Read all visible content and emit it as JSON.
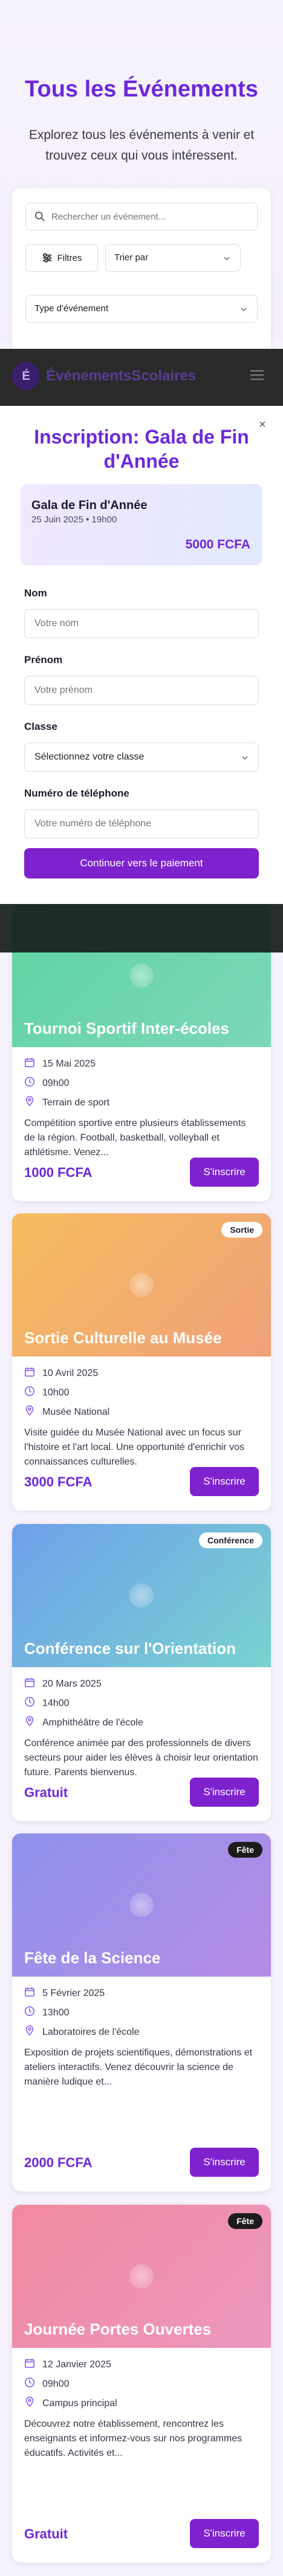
{
  "hero": {
    "title": "Tous les Événements",
    "subtitle": "Explorez tous les événements à venir et trouvez ceux qui vous intéressent."
  },
  "filters": {
    "search_placeholder": "Rechercher un événement...",
    "filter_button": "Filtres",
    "sort_label": "Trier par",
    "type_label": "Type d'événement"
  },
  "navbar": {
    "logo_letter": "É",
    "brand": "ÉvénementsScolaires"
  },
  "modal": {
    "title": "Inscription: Gala de Fin d'Année",
    "summary": {
      "name": "Gala de Fin d'Année",
      "date": "25 Juin 2025 • 19h00",
      "price": "5000 FCFA"
    },
    "form": {
      "name_label": "Nom",
      "name_placeholder": "Votre nom",
      "firstname_label": "Prénom",
      "firstname_placeholder": "Votre prénom",
      "class_label": "Classe",
      "class_value": "Sélectionnez votre classe",
      "phone_label": "Numéro de téléphone",
      "phone_placeholder": "Votre numéro de téléphone"
    },
    "continue_button": "Continuer vers le paiement"
  },
  "events": [
    {
      "title": "Tournoi Sportif Inter-écoles",
      "badge": "",
      "date": "15 Mai 2025",
      "time": "09h00",
      "place": "Terrain de sport",
      "description": "Compétition sportive entre plusieurs établissements de la région. Football, basketball, volleyball et athlétisme. Venez...",
      "price": "1000 FCFA",
      "button": "S'inscrire",
      "gradient": [
        "#5ed3a3",
        "#7dd7b8"
      ]
    },
    {
      "title": "Sortie Culturelle au Musée",
      "badge": "Sortie",
      "date": "10 Avril 2025",
      "time": "10h00",
      "place": "Musée National",
      "description": "Visite guidée du Musée National avec un focus sur l'histoire et l'art local. Une opportunité d'enrichir vos connaissances culturelles.",
      "price": "3000 FCFA",
      "button": "S'inscrire",
      "gradient": [
        "#f4bd5e",
        "#f0a07a"
      ]
    },
    {
      "title": "Conférence sur l'Orientation",
      "badge": "Conférence",
      "date": "20 Mars 2025",
      "time": "14h00",
      "place": "Amphithéâtre de l'école",
      "description": "Conférence animée par des professionnels de divers secteurs pour aider les élèves à choisir leur orientation future. Parents bienvenus.",
      "price": "Gratuit",
      "button": "S'inscrire",
      "gradient": [
        "#6fa0ea",
        "#79d2cf"
      ]
    },
    {
      "title": "Fête de la Science",
      "badge": "Fête",
      "date": "5 Février 2025",
      "time": "13h00",
      "place": "Laboratoires de l'école",
      "description": "Exposition de projets scientifiques, démonstrations et ateliers interactifs. Venez découvrir la science de manière ludique et...",
      "price": "2000 FCFA",
      "button": "S'inscrire",
      "gradient": [
        "#8f92ea",
        "#b58ce6"
      ]
    },
    {
      "title": "Journée Portes Ouvertes",
      "badge": "Fête",
      "date": "12 Janvier 2025",
      "time": "09h00",
      "place": "Campus principal",
      "description": "Découvrez notre établissement, rencontrez les enseignants et informez-vous sur nos programmes éducatifs. Activités et...",
      "price": "Gratuit",
      "button": "S'inscrire",
      "gradient": [
        "#f08aa0",
        "#ec97bf"
      ]
    }
  ]
}
